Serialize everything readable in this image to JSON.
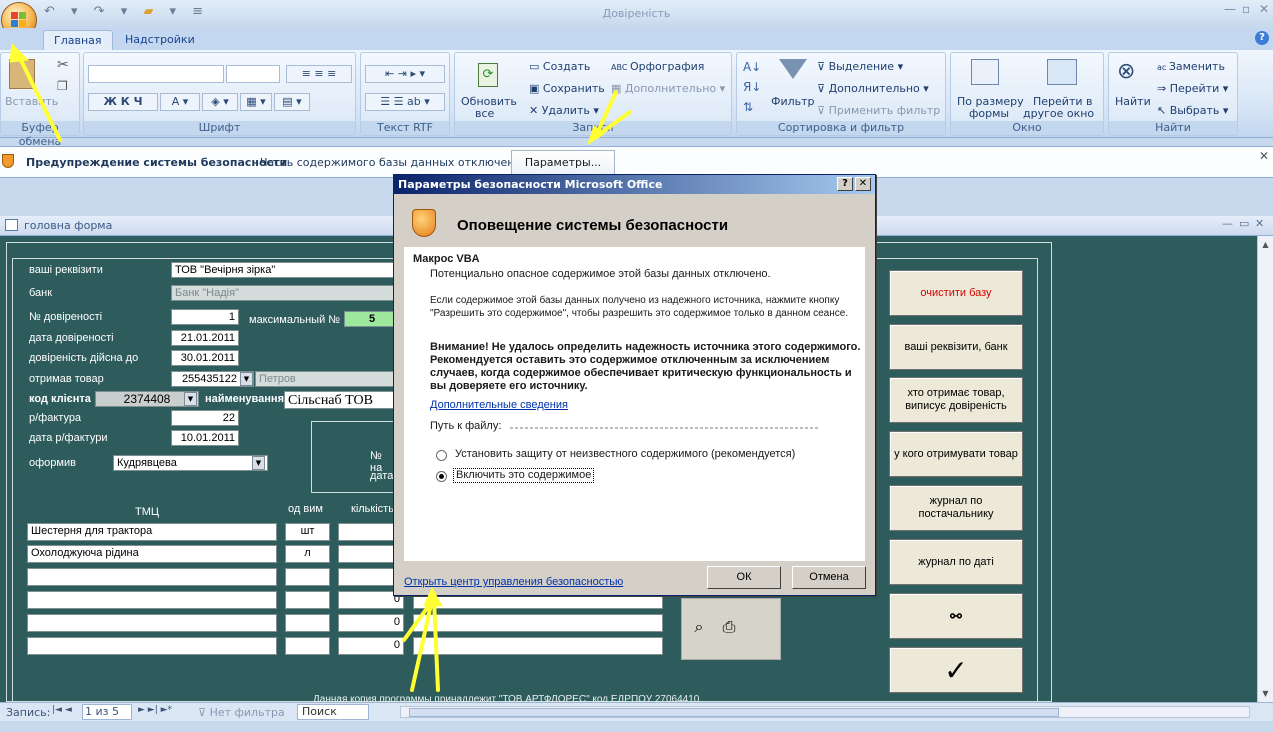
{
  "window": {
    "title": "Довіреність"
  },
  "ribbon": {
    "tabs": [
      "Главная",
      "Надстройки"
    ],
    "groups": {
      "clipboard": {
        "label": "Буфер обмена",
        "paste": "Вставить"
      },
      "font": {
        "label": "Шрифт"
      },
      "rtf": {
        "label": "Текст RTF"
      },
      "records": {
        "label": "Записи",
        "refresh": "Обновить",
        "refresh2": "все",
        "create": "Создать",
        "save": "Сохранить",
        "delete": "Удалить",
        "spelling": "Орфография",
        "more": "Дополнительно"
      },
      "sort": {
        "label": "Сортировка и фильтр",
        "filter": "Фильтр",
        "selection": "Выделение",
        "advanced": "Дополнительно",
        "apply": "Применить фильтр"
      },
      "window": {
        "label": "Окно",
        "fit": "По размеру",
        "fit2": "формы",
        "switch": "Перейти в",
        "switch2": "другое окно"
      },
      "find": {
        "label": "Найти",
        "find": "Найти",
        "replace": "Заменить",
        "goto": "Перейти",
        "select": "Выбрать"
      }
    }
  },
  "security_bar": {
    "title": "Предупреждение системы безопасности",
    "message": "Часть содержимого базы данных отключено",
    "button": "Параметры..."
  },
  "form": {
    "title": "головна форма",
    "labels": {
      "requisites": "ваші реквізити",
      "bank": "банк",
      "num": "№ довіреності",
      "max": "максимальный №",
      "date": "дата довіреності",
      "valid": "довіреність дійсна до",
      "received": "отримав товар",
      "client_code": "код клієнта",
      "name": "найменування",
      "invoice": "р/фактура",
      "invoice_date": "дата р/фактури",
      "issued": "оформив",
      "tmc": "ТМЦ",
      "unit": "од вим",
      "qty": "кількість",
      "num_short": "№ на",
      "date_short": "дата"
    },
    "values": {
      "requisites": "ТОВ \"Вечірня зірка\"",
      "bank": "Банк \"Надія\"",
      "num": "1",
      "max": "5",
      "date": "21.01.2011",
      "valid": "30.01.2011",
      "received": "255435122",
      "received_name": "Петров",
      "client_code": "2374408",
      "name": "Сільснаб ТОВ",
      "invoice": "22",
      "invoice_date": "10.01.2011",
      "issued": "Кудрявцева"
    },
    "items": [
      {
        "name": "Шестерня для трактора",
        "unit": "шт"
      },
      {
        "name": "Охолоджуюча рідина",
        "unit": "л"
      }
    ],
    "qty_zero": [
      "0",
      "0",
      "0"
    ],
    "buttons": {
      "clear": "очистити базу",
      "requisites_bank": "ваші реквізити, банк",
      "who_receives": "хто отримає товар, виписує довіреність",
      "from_whom": "у кого отримувати товар",
      "journal_supplier": "журнал по постачальнику",
      "journal_date": "журнал по даті"
    },
    "footer_text": "Данная копия программы принадлежит \"ТОВ АРТФЛОРЕС\"        код ЕДРПОУ 27064410"
  },
  "status": {
    "record_label": "Запись:",
    "record_pos": "1 из 5",
    "no_filter": "Нет фильтра",
    "search": "Поиск"
  },
  "dialog": {
    "title": "Параметры безопасности Microsoft Office",
    "header": "Оповещение системы безопасности",
    "section": "Макрос VBA",
    "p1": "Потенциально опасное содержимое этой базы данных отключено.",
    "p2": "Если содержимое этой базы данных получено из надежного источника, нажмите кнопку \"Разрешить это содержимое\", чтобы разрешить это содержимое только в данном сеансе.",
    "warning": "Внимание! Не удалось определить надежность источника этого содержимого. Рекомендуется оставить это содержимое отключенным за исключением случаев, когда содержимое обеспечивает критическую функциональность и вы доверяете его источнику.",
    "more_info": "Дополнительные сведения",
    "path_label": "Путь к файлу:",
    "option1": "Установить защиту от неизвестного содержимого (рекомендуется)",
    "option2": "Включить это содержимое",
    "trust_center": "Открыть центр управления безопасностью",
    "ok": "ОК",
    "cancel": "Отмена"
  },
  "colors": {
    "form_bg": "#2e5c5d",
    "ribbon": "#d5e4f5",
    "dialog_title": "#0a246a",
    "annotation_arrow": "#ffff33"
  }
}
